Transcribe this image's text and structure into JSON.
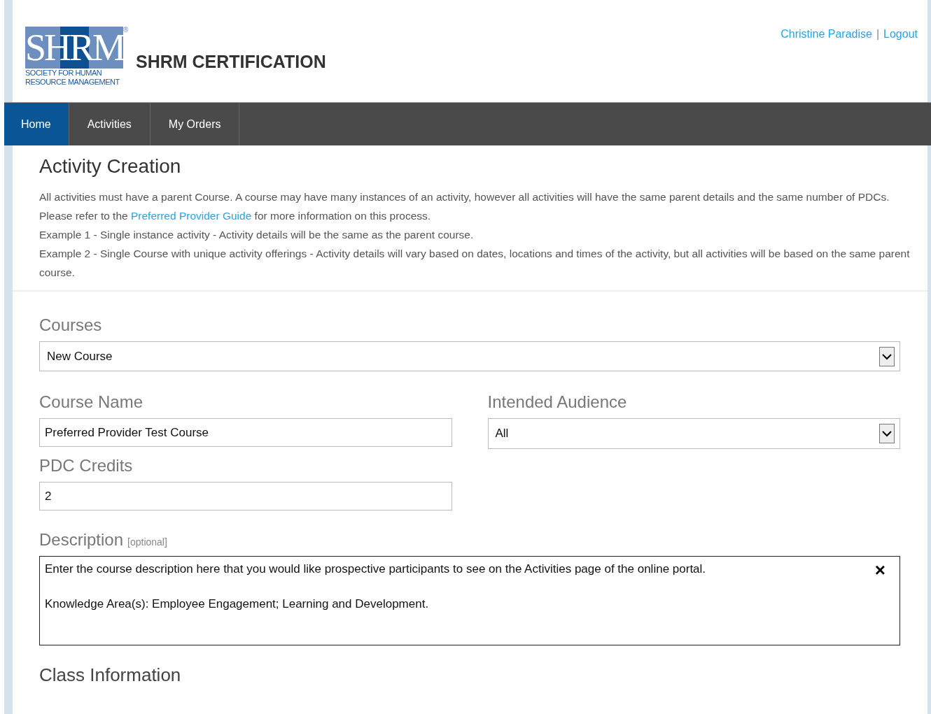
{
  "logo": {
    "letters": "SHRM",
    "registered": "®",
    "tagline": [
      "SOCIETY FOR HUMAN",
      "RESOURCE MANAGEMENT"
    ]
  },
  "site_title": "SHRM CERTIFICATION",
  "user": {
    "name": "Christine Paradise",
    "separator": "|",
    "logout": "Logout"
  },
  "nav": [
    {
      "label": "Home",
      "selected": true
    },
    {
      "label": "Activities",
      "selected": false
    },
    {
      "label": "My Orders",
      "selected": false
    }
  ],
  "page_title": "Activity Creation",
  "intro": [
    {
      "text": "All activities must have a parent Course. A course may have many instances of an activity, however all activities will have the same parent details and the same number of PDCs."
    },
    {
      "before": "Please refer to the ",
      "link": "Preferred Provider Guide",
      "after": " for more information on this process."
    },
    {
      "text": "Example 1 - Single instance activity - Activity details will be the same as the parent course."
    },
    {
      "text": "Example 2 - Single Course with unique activity offerings - Activity details will vary based on dates, locations and times of the activity, but all activities will be based on the same parent course."
    }
  ],
  "courses": {
    "label": "Courses",
    "value": "New Course"
  },
  "course_name": {
    "label": "Course Name",
    "value": "Preferred Provider Test Course"
  },
  "intended_audience": {
    "label": "Intended Audience",
    "value": "All"
  },
  "pdc_credits": {
    "label": "PDC Credits",
    "value": "2"
  },
  "description": {
    "label": "Description",
    "hint": "[optional]",
    "lines": [
      "Enter the course description here that you would like prospective participants to see on the Activities page of the online portal.",
      "Knowledge Area(s):  Employee Engagement; Learning and Development."
    ],
    "clear": "×"
  },
  "next_section": "Class Information"
}
